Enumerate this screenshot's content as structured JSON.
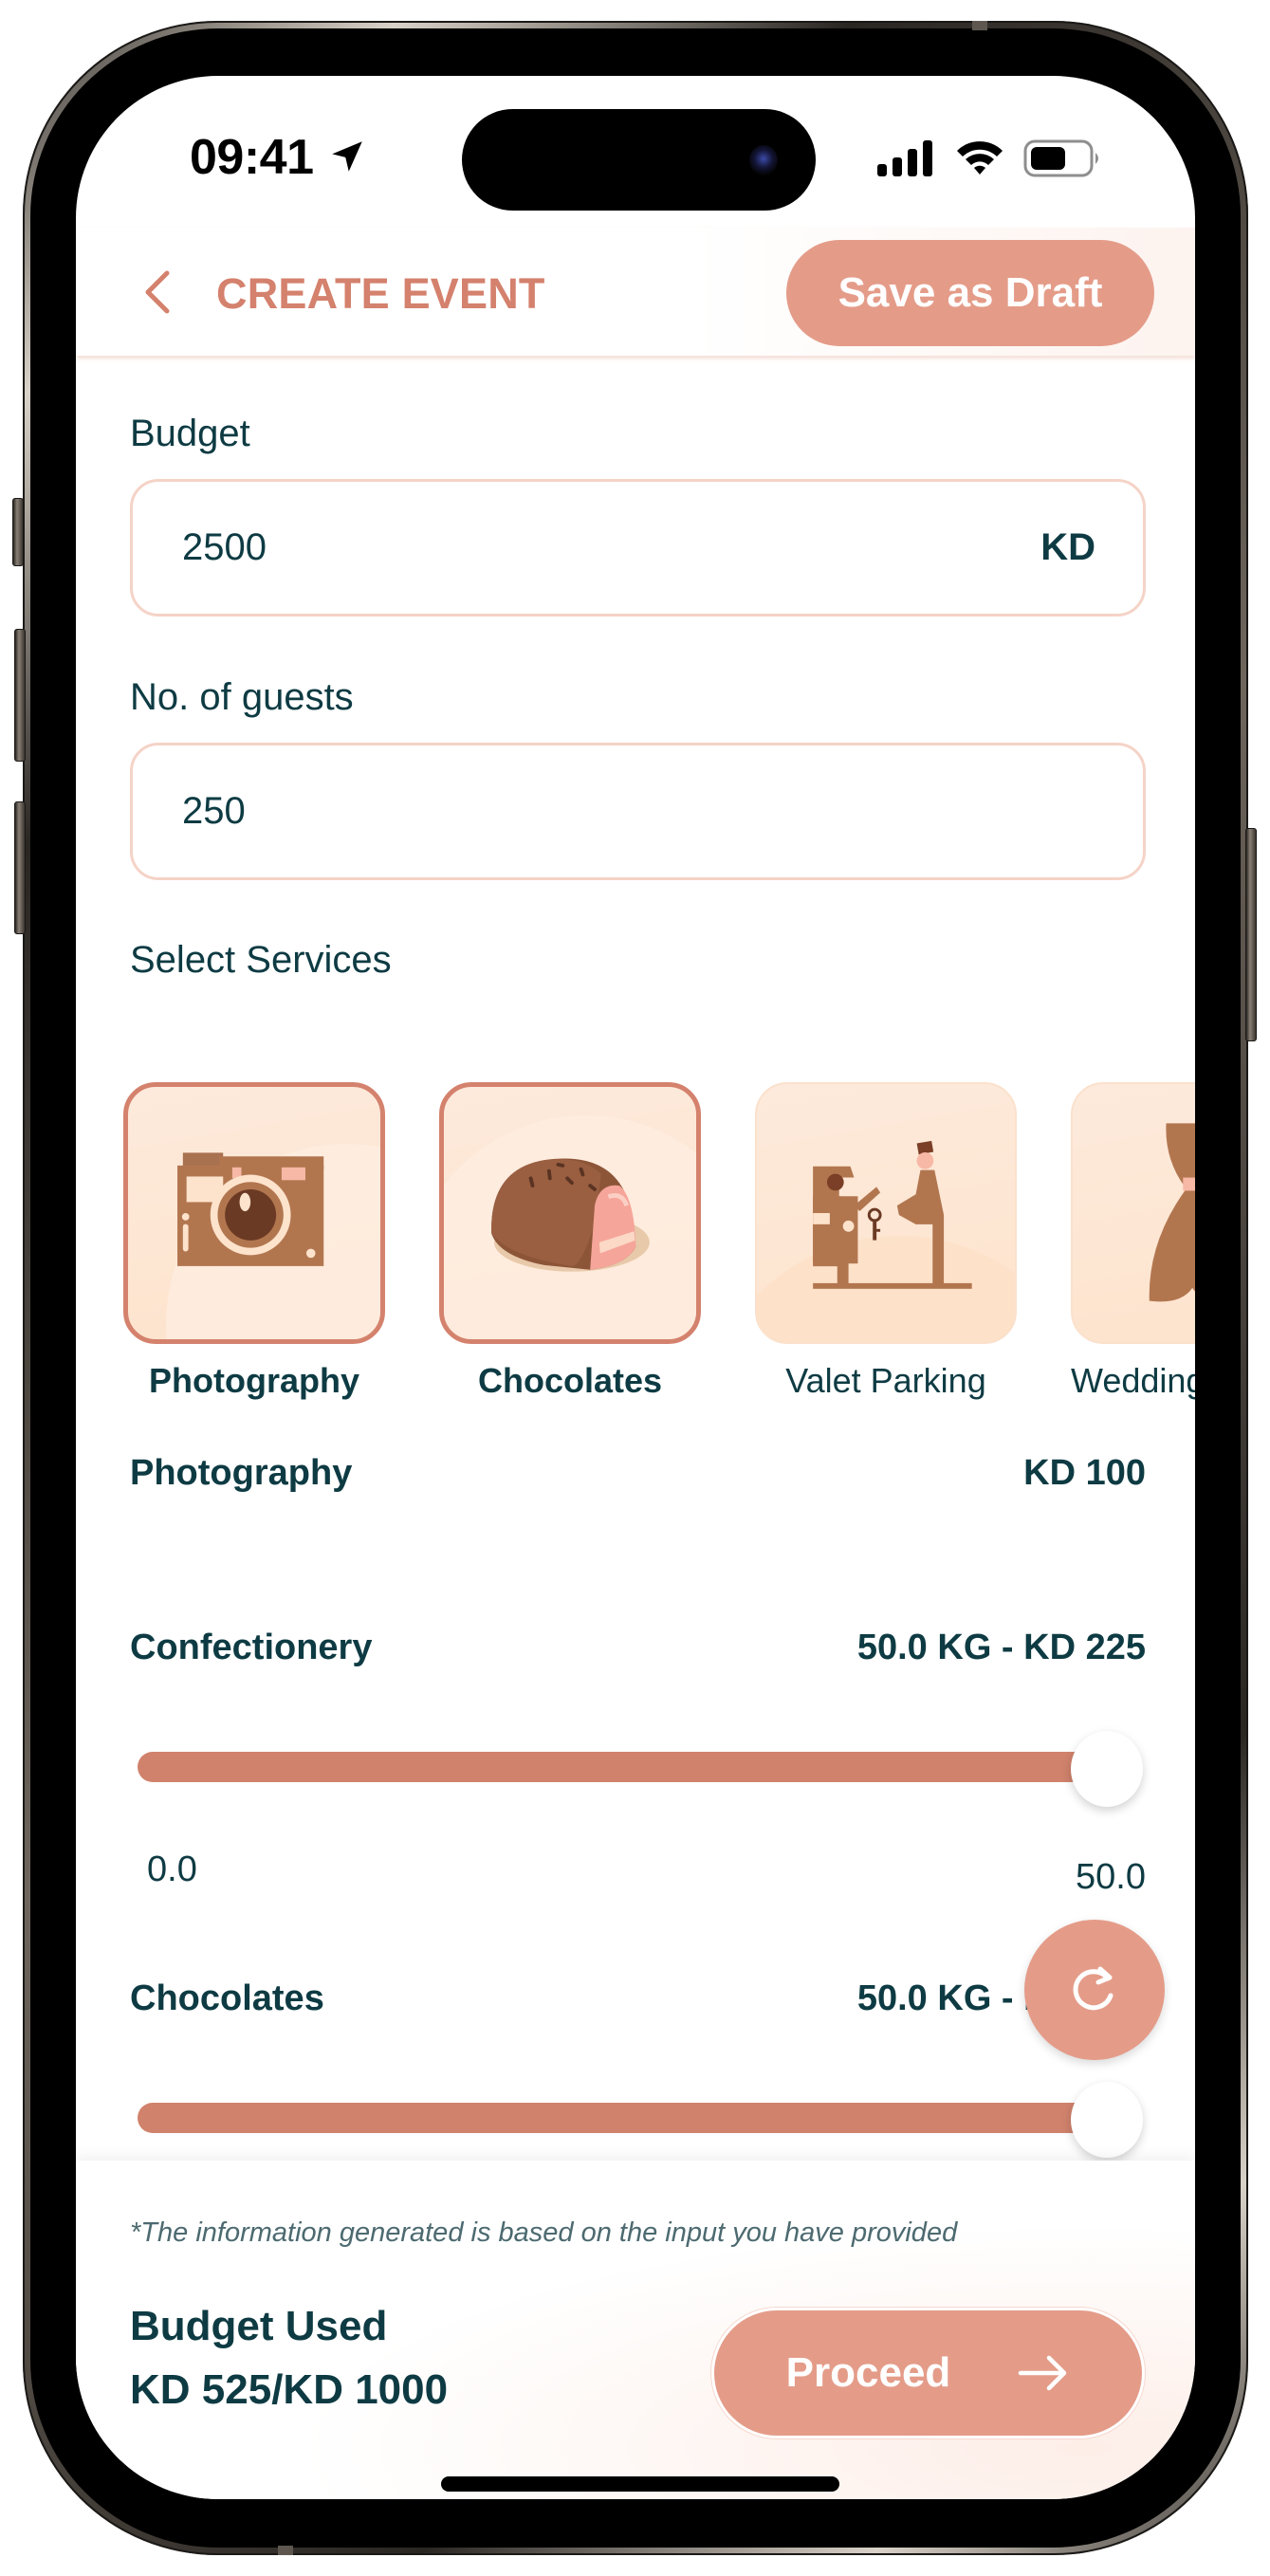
{
  "status_bar": {
    "time": "09:41",
    "icons": [
      "location-arrow-icon",
      "cellular-signal-icon",
      "wifi-icon",
      "battery-icon"
    ]
  },
  "header": {
    "back_icon": "chevron-left-icon",
    "title": "CREATE EVENT",
    "save_draft_label": "Save as Draft"
  },
  "form": {
    "budget": {
      "label": "Budget",
      "value": "2500",
      "suffix": "KD"
    },
    "guests": {
      "label": "No. of guests",
      "value": "250"
    }
  },
  "services": {
    "label": "Select Services",
    "items": [
      {
        "label": "Photography",
        "icon": "camera-icon",
        "selected": true
      },
      {
        "label": "Chocolates",
        "icon": "chocolate-icon",
        "selected": true
      },
      {
        "label": "Valet Parking",
        "icon": "valet-parking-icon",
        "selected": false
      },
      {
        "label": "Wedding",
        "icon": "wedding-dress-icon",
        "selected": false
      }
    ]
  },
  "breakdown": {
    "photography": {
      "title": "Photography",
      "value": "KD 100"
    },
    "confectionery": {
      "title": "Confectionery",
      "value": "50.0 KG - KD 225",
      "slider": {
        "min": 0,
        "max": 50,
        "value": 50,
        "min_label": "0.0",
        "max_label": "50.0"
      }
    },
    "chocolates": {
      "title": "Chocolates",
      "value": "50.0 KG - KD 225",
      "slider": {
        "min": 0,
        "max": 50,
        "value": 50
      }
    }
  },
  "fab": {
    "icon": "refresh-icon"
  },
  "footer": {
    "note": "*The information generated is based on the input you have provided",
    "budget_used_label": "Budget Used",
    "budget_used_value": "KD 525/KD 1000",
    "proceed_label": "Proceed",
    "proceed_icon": "arrow-right-icon"
  },
  "colors": {
    "accent": "#e49c89",
    "accent_dark": "#d4816d",
    "slider": "#d0826c",
    "text": "#0e3b43",
    "card_bg": "#fde3cc",
    "input_border": "#f5d3c7"
  }
}
